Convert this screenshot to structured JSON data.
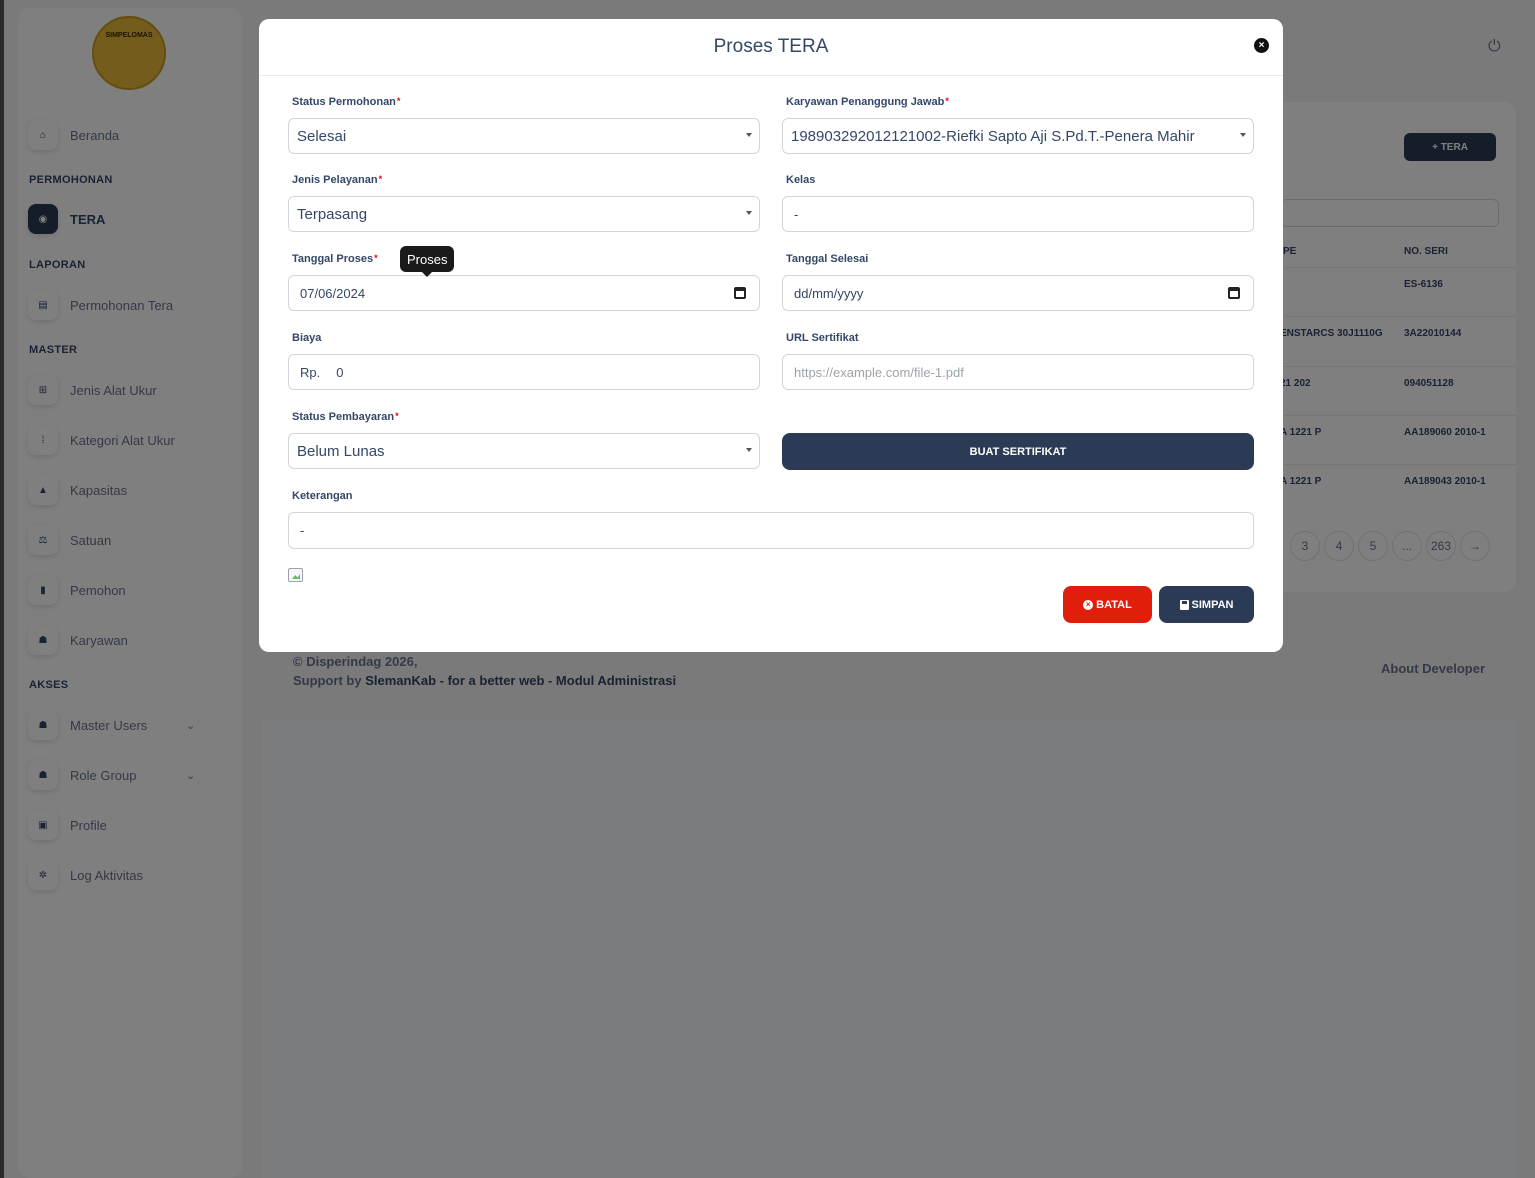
{
  "sidebar": {
    "logo_text": "SIMPELOMAS",
    "items": [
      {
        "label": "Beranda",
        "icon": "home-icon"
      },
      {
        "section": "PERMOHONAN"
      },
      {
        "label": "TERA",
        "icon": "gauge-icon",
        "active": true
      },
      {
        "section": "LAPORAN"
      },
      {
        "label": "Permohonan Tera",
        "icon": "document-icon"
      },
      {
        "section": "MASTER"
      },
      {
        "label": "Jenis Alat Ukur",
        "icon": "sitemap-icon"
      },
      {
        "label": "Kategori Alat Ukur",
        "icon": "grid-icon"
      },
      {
        "label": "Kapasitas",
        "icon": "weight-icon"
      },
      {
        "label": "Satuan",
        "icon": "scale-icon"
      },
      {
        "label": "Pemohon",
        "icon": "building-icon"
      },
      {
        "label": "Karyawan",
        "icon": "users-icon"
      },
      {
        "section": "AKSES"
      },
      {
        "label": "Master Users",
        "icon": "users-gear-icon"
      },
      {
        "label": "Role Group",
        "icon": "user-group-icon"
      },
      {
        "label": "Profile",
        "icon": "id-card-icon"
      },
      {
        "label": "Log Aktivitas",
        "icon": "log-icon"
      }
    ]
  },
  "background": {
    "add_button": "+ TERA",
    "columns": [
      "PE",
      "NO. SERI"
    ],
    "rows": [
      {
        "tipe": "",
        "seri": "ES-6136"
      },
      {
        "tipe": "ENSTARCS 30J1110G",
        "seri": "3A22010144"
      },
      {
        "tipe": "21 202",
        "seri": "094051128"
      },
      {
        "tipe": "A 1221 P",
        "seri": "AA189060 2010-1"
      },
      {
        "tipe": "A 1221 P",
        "seri": "AA189043 2010-1"
      }
    ],
    "pages": [
      "3",
      "4",
      "5",
      "...",
      "263",
      "→"
    ],
    "footer_line1": "© Disperindag 2026,",
    "footer_support": "Support by",
    "footer_brand": "SlemanKab - for a better web - Modul Administrasi",
    "about_developer": "About Developer"
  },
  "modal": {
    "title": "Proses TERA",
    "status_permohonan": {
      "label": "Status Permohonan",
      "value": "Selesai"
    },
    "karyawan": {
      "label": "Karyawan Penanggung Jawab",
      "value": "198903292012121002-Riefki Sapto Aji S.Pd.T.-Penera Mahir"
    },
    "jenis_pelayanan": {
      "label": "Jenis Pelayanan",
      "value": "Terpasang"
    },
    "kelas": {
      "label": "Kelas",
      "value": "-"
    },
    "tanggal_proses": {
      "label": "Tanggal Proses",
      "value": "07/06/2024",
      "tooltip": "Proses"
    },
    "tanggal_selesai": {
      "label": "Tanggal Selesai",
      "value": "dd/mm/yyyy"
    },
    "biaya": {
      "label": "Biaya",
      "prefix": "Rp.",
      "value": "0"
    },
    "url_sertifikat": {
      "label": "URL Sertifikat",
      "placeholder": "https://example.com/file-1.pdf"
    },
    "status_pembayaran": {
      "label": "Status Pembayaran",
      "value": "Belum Lunas"
    },
    "keterangan": {
      "label": "Keterangan",
      "value": "-"
    },
    "buat_sertifikat": "BUAT SERTIFIKAT",
    "batal": "BATAL",
    "simpan": "SIMPAN"
  },
  "colors": {
    "primary": "#2b3a55",
    "danger": "#e11d0c",
    "required": "#ea0606"
  }
}
